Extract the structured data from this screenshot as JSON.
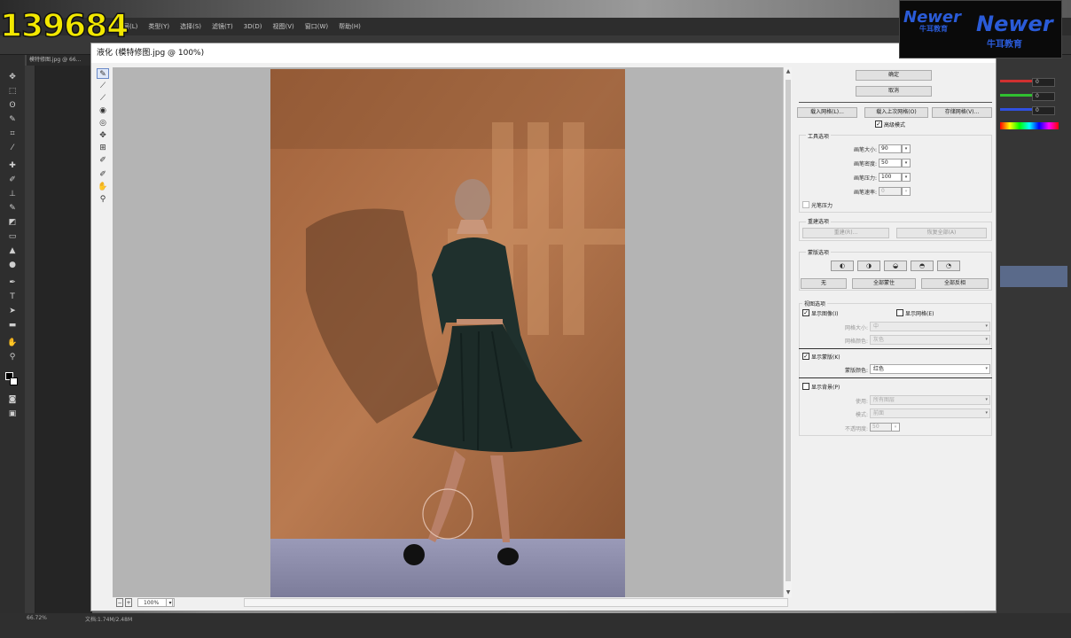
{
  "counter": "139684",
  "watermark": {
    "brand_left": "Newer",
    "brand_right": "Newer",
    "cn_left": "牛耳教育",
    "cn_right": "牛耳教育"
  },
  "menubar": [
    "图层(L)",
    "类型(Y)",
    "选择(S)",
    "滤镜(T)",
    "3D(D)",
    "视图(V)",
    "窗口(W)",
    "帮助(H)"
  ],
  "doc_tab": "模特修图.jpg @ 66...",
  "status": {
    "zoom": "66.72%",
    "doc": "文档:1.74M/2.48M"
  },
  "dialog": {
    "title": "液化 (模特修图.jpg @ 100%)",
    "zoom": "100%",
    "buttons": {
      "ok": "确定",
      "cancel": "取消",
      "load_mesh": "载入网格(L)...",
      "load_last_mesh": "载入上次网格(O)",
      "save_mesh": "存储网格(V)..."
    },
    "advanced_mode": "高级模式",
    "tool_options": {
      "title": "工具选项",
      "brush_size_label": "画笔大小:",
      "brush_size": "90",
      "brush_density_label": "画笔密度:",
      "brush_density": "50",
      "brush_pressure_label": "画笔压力:",
      "brush_pressure": "100",
      "brush_rate_label": "画笔速率:",
      "brush_rate": "0",
      "stylus_label": "光笔压力"
    },
    "reconstruct": {
      "title": "重建选项",
      "reconstruct_btn": "重建(R)...",
      "restore_all_btn": "恢复全部(A)"
    },
    "mask": {
      "title": "蒙版选项",
      "none_btn": "无",
      "mask_all_btn": "全部蒙住",
      "invert_all_btn": "全部反相"
    },
    "view": {
      "title": "视图选项",
      "show_image": "显示图像(I)",
      "show_mesh": "显示网格(E)",
      "mesh_size_label": "网格大小:",
      "mesh_size": "中",
      "mesh_color_label": "网格颜色:",
      "mesh_color": "灰色",
      "show_mask": "显示蒙版(K)",
      "mask_color_label": "蒙版颜色:",
      "mask_color": "红色",
      "show_backdrop": "显示背景(P)",
      "use_label": "使用:",
      "use": "所有图层",
      "mode_label": "模式:",
      "mode": "前面",
      "opacity_label": "不透明度:",
      "opacity": "50"
    }
  },
  "right_panel": {
    "r": "0",
    "g": "0",
    "b": "0"
  }
}
